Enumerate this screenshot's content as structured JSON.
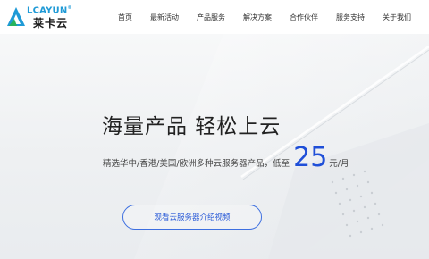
{
  "brand": {
    "logo_word": "LCAYUN",
    "logo_reg": "®",
    "logo_cn": "莱卡云",
    "accent_blue": "#1f9ad6",
    "accent_green": "#27b35c"
  },
  "nav": {
    "items": [
      {
        "label": "首页"
      },
      {
        "label": "最新活动"
      },
      {
        "label": "产品服务"
      },
      {
        "label": "解决方案"
      },
      {
        "label": "合作伙伴"
      },
      {
        "label": "服务支持"
      },
      {
        "label": "关于我们"
      }
    ]
  },
  "hero": {
    "title": "海量产品 轻松上云",
    "subtitle": "精选华中/香港/美国/欧洲多种云服务器产品，低至",
    "price": "25",
    "unit": "元/月",
    "price_color": "#1f4fd8",
    "button_label": "观看云服务器介绍视频"
  }
}
